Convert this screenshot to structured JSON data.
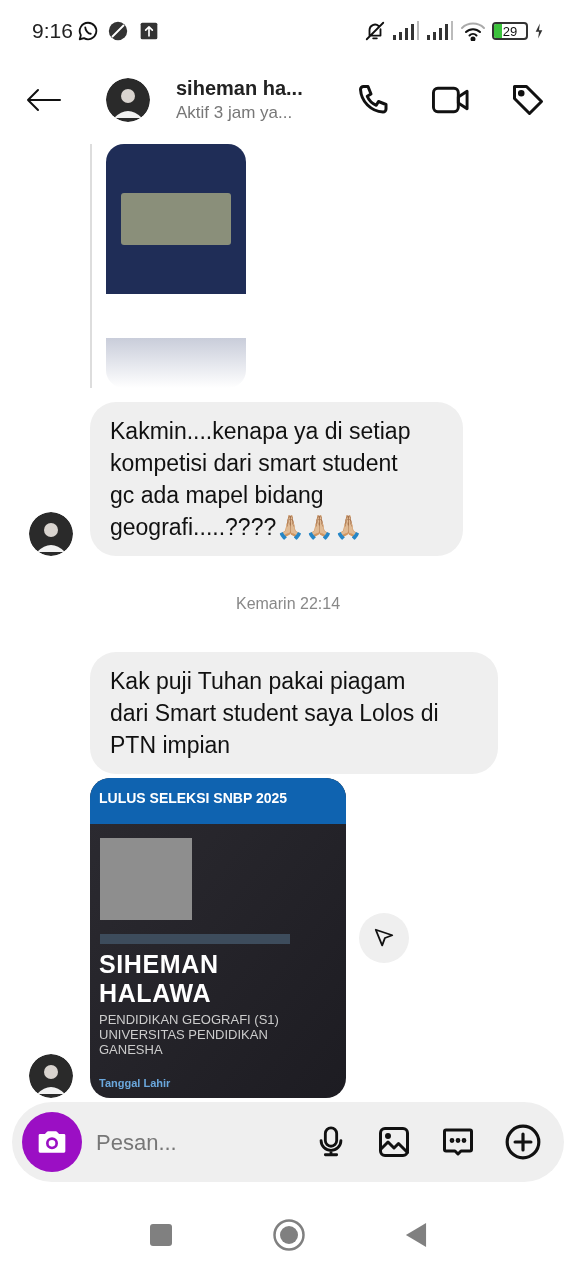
{
  "status_bar": {
    "time": "9:16",
    "battery": "29",
    "charging": true
  },
  "header": {
    "name": "siheman ha...",
    "status": "Aktif 3 jam ya..."
  },
  "messages": [
    {
      "kind": "image",
      "avatar": false,
      "quoted": true
    },
    {
      "kind": "text",
      "text": "Kakmin....kenapa ya di setiap kompetisi dari smart student gc ada mapel bidang geografi.....????🙏🏼🙏🏼🙏🏼",
      "avatar": true
    },
    {
      "kind": "timestamp",
      "text": "Kemarin 22:14"
    },
    {
      "kind": "text",
      "text": "Kak puji Tuhan pakai piagam dari Smart student saya Lolos di PTN impian",
      "avatar": false
    },
    {
      "kind": "card",
      "avatar": true,
      "banner": "LULUS SELEKSI SNBP 2025",
      "name": "SIHEMAN HALAWA",
      "program": "PENDIDIKAN GEOGRAFI (S1) UNIVERSITAS PENDIDIKAN GANESHA",
      "field_label": "Tanggal Lahir"
    }
  ],
  "composer": {
    "placeholder": "Pesan..."
  }
}
